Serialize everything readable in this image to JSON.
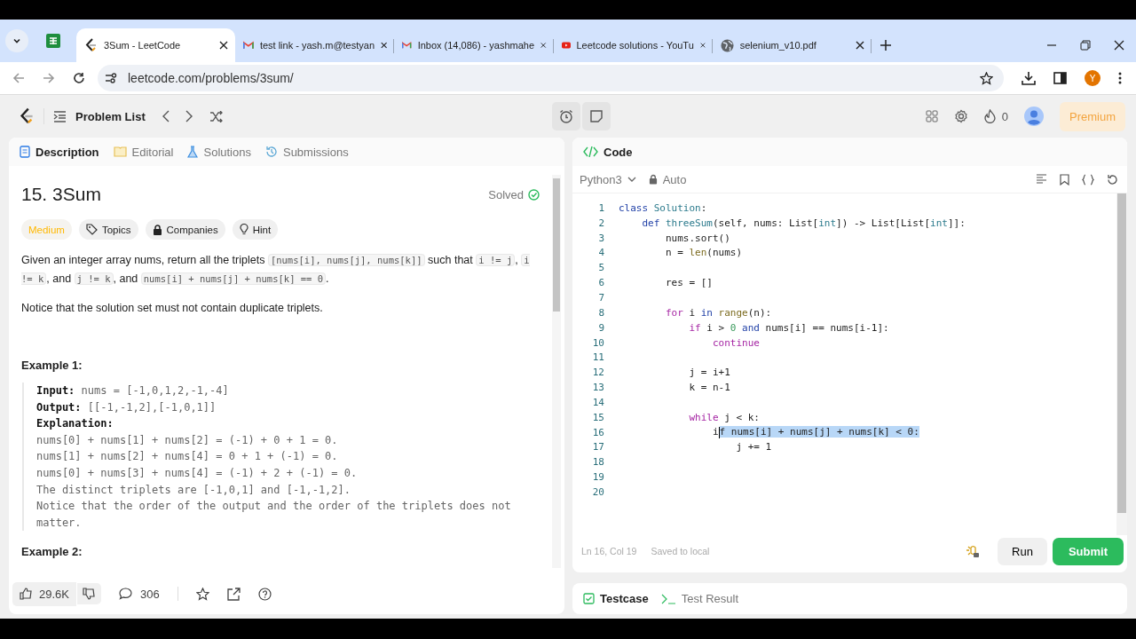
{
  "browser": {
    "tabs": [
      {
        "kind": "leetcode",
        "title": "3Sum - LeetCode",
        "selected": true
      },
      {
        "kind": "gmail",
        "title": "test link - yash.m@testyan",
        "selected": false
      },
      {
        "kind": "gmail",
        "title": "Inbox (14,086) - yashmahe",
        "selected": false
      },
      {
        "kind": "youtube",
        "title": "Leetcode solutions - YouTu",
        "selected": false
      },
      {
        "kind": "web",
        "title": "selenium_v10.pdf",
        "selected": false
      }
    ],
    "address": "leetcode.com/problems/3sum/",
    "profile": "Y"
  },
  "navbar": {
    "problem_list": "Problem List",
    "streak": "0",
    "premium": "Premium"
  },
  "description": {
    "tabs": [
      {
        "label": "Description",
        "selected": true
      },
      {
        "label": "Editorial",
        "selected": false
      },
      {
        "label": "Solutions",
        "selected": false
      },
      {
        "label": "Submissions",
        "selected": false
      }
    ],
    "title": "15. 3Sum",
    "status": "Solved",
    "difficulty": "Medium",
    "chips": [
      "Topics",
      "Companies",
      "Hint"
    ],
    "paragraphs": [
      [
        {
          "text": "Given an integer array nums, return all the triplets "
        },
        {
          "text": "[nums[i], nums[j], nums[k]]",
          "code": true
        },
        {
          "text": " such that "
        },
        {
          "text": "i != j",
          "code": true
        },
        {
          "text": ", "
        },
        {
          "text": "i != k",
          "code": true
        },
        {
          "text": ", and "
        },
        {
          "text": "j != k",
          "code": true
        },
        {
          "text": ", and "
        },
        {
          "text": "nums[i] + nums[j] + nums[k] == 0",
          "code": true
        },
        {
          "text": "."
        }
      ],
      [
        {
          "text": "Notice that the solution set must not contain duplicate triplets."
        }
      ]
    ],
    "examples": [
      {
        "heading": "Example 1:",
        "lines": [
          "**Input:** nums = [-1,0,1,2,-1,-4]",
          "**Output:** [[-1,-1,2],[-1,0,1]]",
          "**Explanation:**",
          "nums[0] + nums[1] + nums[2] = (-1) + 0 + 1 = 0.",
          "nums[1] + nums[2] + nums[4] = 0 + 1 + (-1) = 0.",
          "nums[0] + nums[3] + nums[4] = (-1) + 2 + (-1) = 0.",
          "The distinct triplets are [-1,0,1] and [-1,-1,2].",
          "Notice that the order of the output and the order of the triplets does not matter."
        ]
      },
      {
        "heading": "Example 2:"
      }
    ],
    "likes": "29.6K",
    "comments": "306"
  },
  "editor": {
    "title": "Code",
    "language": "Python3",
    "mode": "Auto",
    "lines": [
      {
        "n": "1",
        "tokens": [
          {
            "t": "class",
            "kind": "kw"
          },
          {
            "t": " Solution",
            "kind": "type"
          },
          {
            "t": ":"
          }
        ]
      },
      {
        "n": "2",
        "tokens": [
          {
            "t": "    def",
            "kind": "kw"
          },
          {
            "t": " threeSum",
            "kind": "type"
          },
          {
            "t": "(self, nums: List["
          },
          {
            "t": "int",
            "kind": "type"
          },
          {
            "t": "]) -> List[List["
          },
          {
            "t": "int",
            "kind": "type"
          },
          {
            "t": "]]:"
          }
        ]
      },
      {
        "n": "3",
        "tokens": [
          {
            "t": "        nums.sort()"
          }
        ]
      },
      {
        "n": "4",
        "tokens": [
          {
            "t": "        n = "
          },
          {
            "t": "len",
            "kind": "fn"
          },
          {
            "t": "(nums)"
          }
        ]
      },
      {
        "n": "5"
      },
      {
        "n": "6",
        "tokens": [
          {
            "t": "        res = []"
          }
        ]
      },
      {
        "n": "7"
      },
      {
        "n": "8",
        "tokens": [
          {
            "t": "        for",
            "kind": "ctrl"
          },
          {
            "t": " i "
          },
          {
            "t": "in",
            "kind": "kw"
          },
          {
            "t": " range",
            "kind": "fn"
          },
          {
            "t": "(n):"
          }
        ]
      },
      {
        "n": "9",
        "tokens": [
          {
            "t": "            if",
            "kind": "ctrl"
          },
          {
            "t": " i > "
          },
          {
            "t": "0",
            "kind": "num"
          },
          {
            "t": " and",
            "kind": "kw"
          },
          {
            "t": " nums[i] == nums[i-1]:"
          }
        ]
      },
      {
        "n": "10",
        "tokens": [
          {
            "t": "                continue",
            "kind": "ctrl"
          }
        ]
      },
      {
        "n": "11"
      },
      {
        "n": "12",
        "tokens": [
          {
            "t": "            j = i+1"
          }
        ]
      },
      {
        "n": "13",
        "tokens": [
          {
            "t": "            k = n-1"
          }
        ]
      },
      {
        "n": "14"
      },
      {
        "n": "15",
        "tokens": [
          {
            "t": "            while",
            "kind": "ctrl"
          },
          {
            "t": " j < k:"
          }
        ]
      },
      {
        "n": "16",
        "tokens": [
          {
            "t": "                i"
          },
          {
            "t": "f nums[i] + nums[j] + nums[k] < 0:",
            "kind": "sel"
          }
        ]
      },
      {
        "n": "17",
        "tokens": [
          {
            "t": "                    j += 1"
          }
        ]
      },
      {
        "n": "18"
      },
      {
        "n": "19"
      },
      {
        "n": "20"
      }
    ],
    "cursor": "Ln 16, Col 19",
    "saved": "Saved to local",
    "run": "Run",
    "submit": "Submit"
  },
  "console": {
    "tabs": [
      {
        "label": "Testcase",
        "selected": true
      },
      {
        "label": "Test Result",
        "selected": false
      }
    ]
  }
}
